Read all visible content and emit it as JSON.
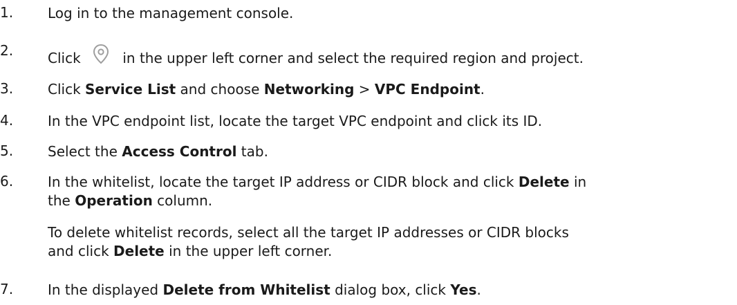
{
  "steps": [
    {
      "num": "1.",
      "text": "Log in to the management console."
    },
    {
      "num": "2.",
      "pre": "Click",
      "icon": "location-pin-icon",
      "post": "in the upper left corner and select the required region and project."
    },
    {
      "num": "3.",
      "t1": "Click ",
      "b1": "Service List",
      "t2": " and choose ",
      "b2": "Networking",
      "t3": " > ",
      "b3": "VPC Endpoint",
      "t4": "."
    },
    {
      "num": "4.",
      "text": "In the VPC endpoint list, locate the target VPC endpoint and click its ID."
    },
    {
      "num": "5.",
      "t1": "Select the ",
      "b1": "Access Control",
      "t2": " tab."
    },
    {
      "num": "6.",
      "t1": "In the whitelist, locate the target IP address or CIDR block and click ",
      "b1": "Delete",
      "t2": " in",
      "t3": "the ",
      "b2": "Operation",
      "t4": " column.",
      "note1": "To delete whitelist records, select all the target IP addresses or CIDR blocks",
      "note2_t1": "and click ",
      "note2_b1": "Delete",
      "note2_t2": " in the upper left corner."
    },
    {
      "num": "7.",
      "t1": "In the displayed ",
      "b1": "Delete from Whitelist",
      "t2": " dialog box, click ",
      "b2": "Yes",
      "t3": "."
    }
  ],
  "icon_color": "#9e9e9e"
}
